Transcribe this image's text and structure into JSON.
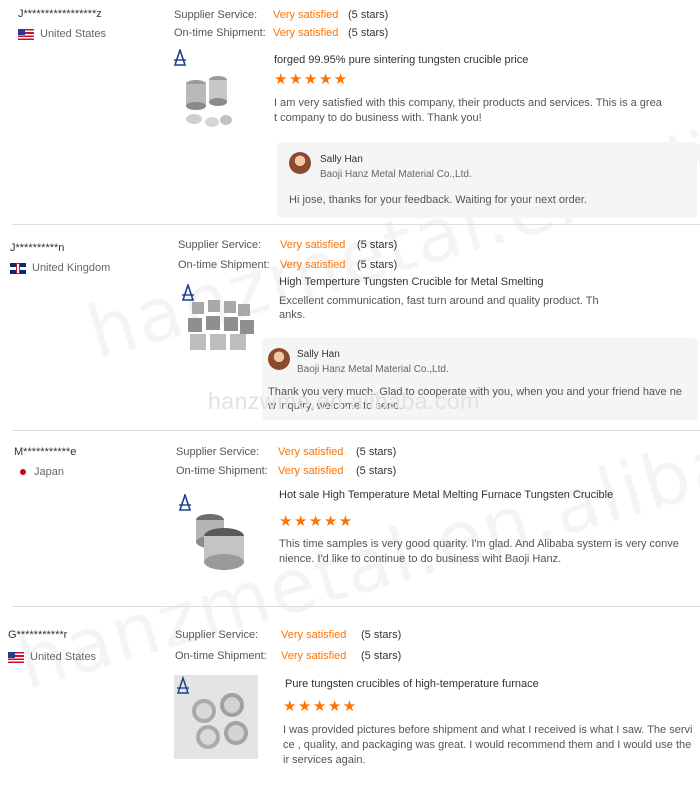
{
  "watermark": {
    "text": "hanzmetal.en.alibaba.com",
    "center_text": "hanzwmo.en.alibaba.com"
  },
  "labels": {
    "supplier_service": "Supplier Service:",
    "ontime_shipment": "On-time Shipment:"
  },
  "colors": {
    "accent": "#ff7300",
    "divider": "#dcdcdc",
    "reply_bg": "#f5f5f5"
  },
  "reviews": [
    {
      "buyer": "J*****************z",
      "country": "United States",
      "supplier_service": {
        "value": "Very satisfied",
        "stars_text": "(5 stars)"
      },
      "ontime_shipment": {
        "value": "Very satisfied",
        "stars_text": "(5 stars)"
      },
      "product_title": "forged 99.95% pure sintering tungsten crucible price",
      "stars": "★★★★★",
      "rating": 5,
      "review_text": "I am very satisfied with this company, their products and services. This is a great company to do business with. Thank you!",
      "reply": {
        "name": "Sally Han",
        "company": "Baoji Hanz Metal Material Co.,Ltd.",
        "text": "Hi jose, thanks for your feedback. Waiting for your next order."
      }
    },
    {
      "buyer": "J**********n",
      "country": "United Kingdom",
      "supplier_service": {
        "value": "Very satisfied",
        "stars_text": "(5 stars)"
      },
      "ontime_shipment": {
        "value": "Very satisfied",
        "stars_text": "(5 stars)"
      },
      "product_title": "High Temperture Tungsten Crucible for Metal Smelting",
      "review_text": "Excellent communication, fast turn around and quality product. Thanks.",
      "reply": {
        "name": "Sally Han",
        "company": "Baoji Hanz Metal Material Co.,Ltd.",
        "text": "Thank you very much. Glad to cooperate with you, when you and your friend have new inquiry, welcome to send."
      }
    },
    {
      "buyer": "M***********e",
      "country": "Japan",
      "supplier_service": {
        "value": "Very satisfied",
        "stars_text": "(5 stars)"
      },
      "ontime_shipment": {
        "value": "Very satisfied",
        "stars_text": "(5 stars)"
      },
      "product_title": "Hot sale High Temperature Metal Melting Furnace Tungsten Crucible",
      "stars": "★★★★★",
      "rating": 5,
      "review_text": "This time samples is very good quarity. I'm glad. And Alibaba system is very convenience. I'd like to continue to do business wiht Baoji Hanz."
    },
    {
      "buyer": "G***********r",
      "country": "United States",
      "supplier_service": {
        "value": "Very satisfied",
        "stars_text": "(5 stars)"
      },
      "ontime_shipment": {
        "value": "Very satisfied",
        "stars_text": "(5 stars)"
      },
      "product_title": "Pure tungsten crucibles of high-temperature furnace",
      "stars": "★★★★★",
      "rating": 5,
      "review_text": "I was provided pictures before shipment and what I received is what I saw. The service , quality, and packaging was great. I would recommend them and I would use their services again."
    }
  ]
}
